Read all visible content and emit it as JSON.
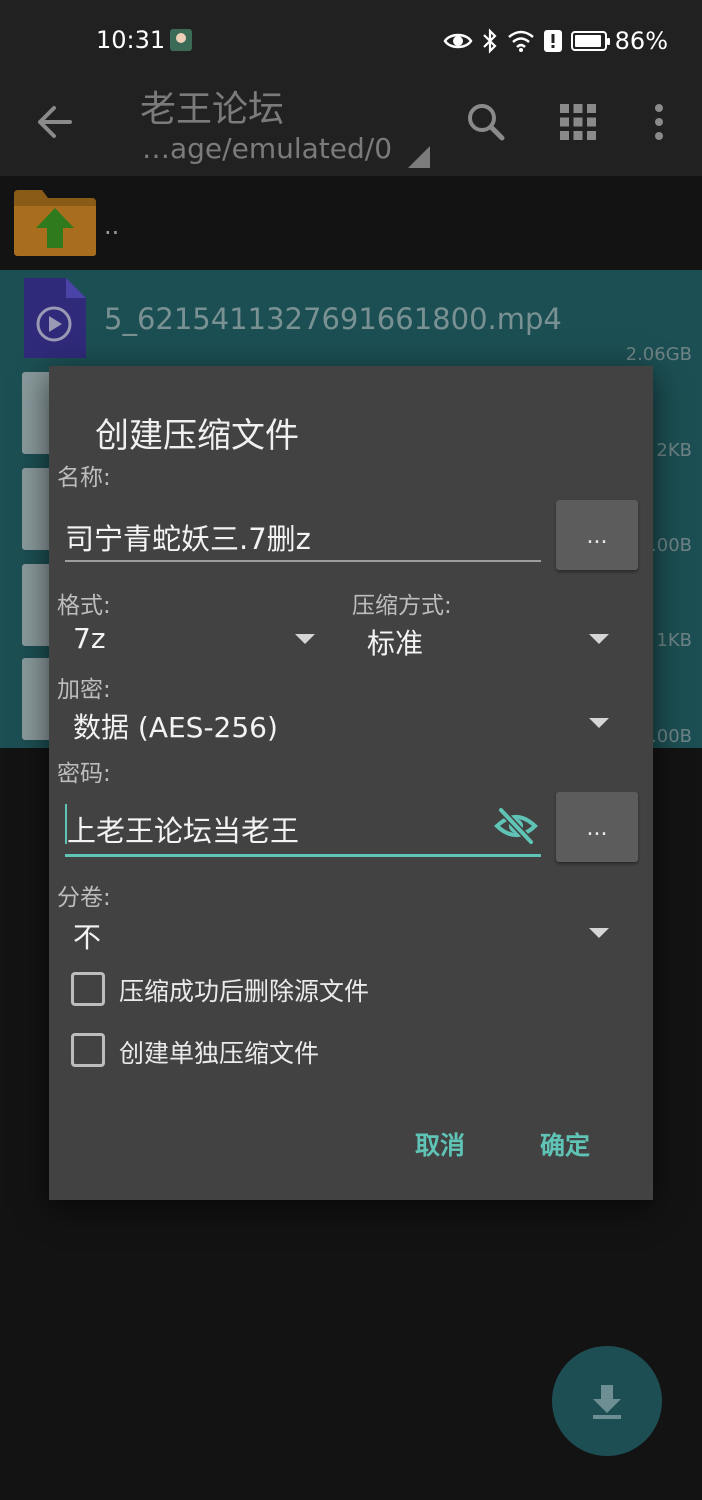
{
  "status_bar": {
    "time": "10:31",
    "battery_percent": "86%"
  },
  "toolbar": {
    "title": "老王论坛",
    "path": "…age/emulated/0"
  },
  "file_list": {
    "parent_label": "..",
    "selected_file": {
      "name": "5_6215411327691661800.mp4",
      "size": "2.06GB"
    },
    "side_sizes": [
      "2KB",
      ".00B",
      "1KB",
      ".00B"
    ]
  },
  "dialog": {
    "title": "创建压缩文件",
    "name_label": "名称:",
    "name_value": "司宁青蛇妖三.7删z",
    "browse_label": "...",
    "format_label": "格式:",
    "format_value": "7z",
    "compression_label": "压缩方式:",
    "compression_value": "标准",
    "encryption_label": "加密:",
    "encryption_value": "数据 (AES-256)",
    "password_label": "密码:",
    "password_value": "上老王论坛当老王",
    "split_label": "分卷:",
    "split_value": "不",
    "delete_source_label": "压缩成功后删除源文件",
    "delete_source_checked": false,
    "separate_archives_label": "创建单独压缩文件",
    "separate_archives_checked": false,
    "cancel_label": "取消",
    "ok_label": "确定"
  },
  "colors": {
    "accent": "#5fc4b6",
    "dialog_bg": "#424242",
    "selection_bg": "#1c4f53"
  }
}
